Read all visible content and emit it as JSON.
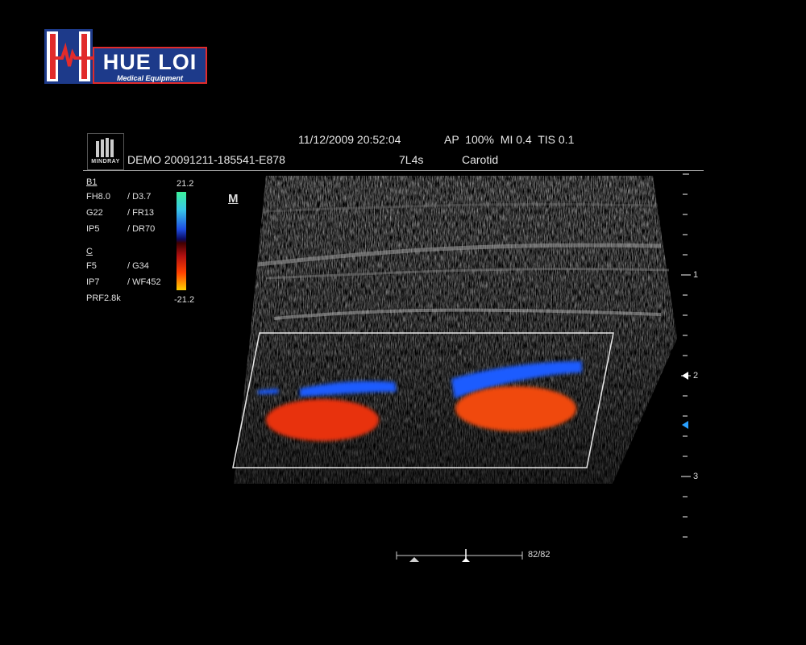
{
  "logo": {
    "brand": "HUE LOI",
    "subtitle": "Medical Equipment"
  },
  "header": {
    "badge_text": "MINDRAY",
    "datetime": "11/12/2009 20:52:04",
    "acoustic": "AP  100%  MI 0.4  TIS 0.1",
    "patient_id": "DEMO 20091211-185541-E878",
    "probe": "7L4s",
    "preset": "Carotid"
  },
  "params": {
    "b_header": "B1",
    "b_rows": [
      {
        "left": "FH8.0",
        "right": "/ D3.7"
      },
      {
        "left": "G22",
        "right": "/ FR13"
      },
      {
        "left": "IP5",
        "right": "/ DR70"
      }
    ],
    "c_header": "C",
    "c_rows": [
      {
        "left": "F5",
        "right": "/ G34"
      },
      {
        "left": "IP7",
        "right": "/ WF452"
      }
    ],
    "prf": "PRF2.8k"
  },
  "color_scale": {
    "max": "21.2",
    "min": "-21.2"
  },
  "m_marker": "M",
  "depth_scale": {
    "labels": [
      "1",
      "2",
      "3"
    ]
  },
  "frame": {
    "counter": "82/82"
  },
  "colors": {
    "flow_red": "#e8300a",
    "flow_blue": "#1a5cff",
    "logo_red": "#e12b2b",
    "logo_blue": "#1d3a8a"
  }
}
